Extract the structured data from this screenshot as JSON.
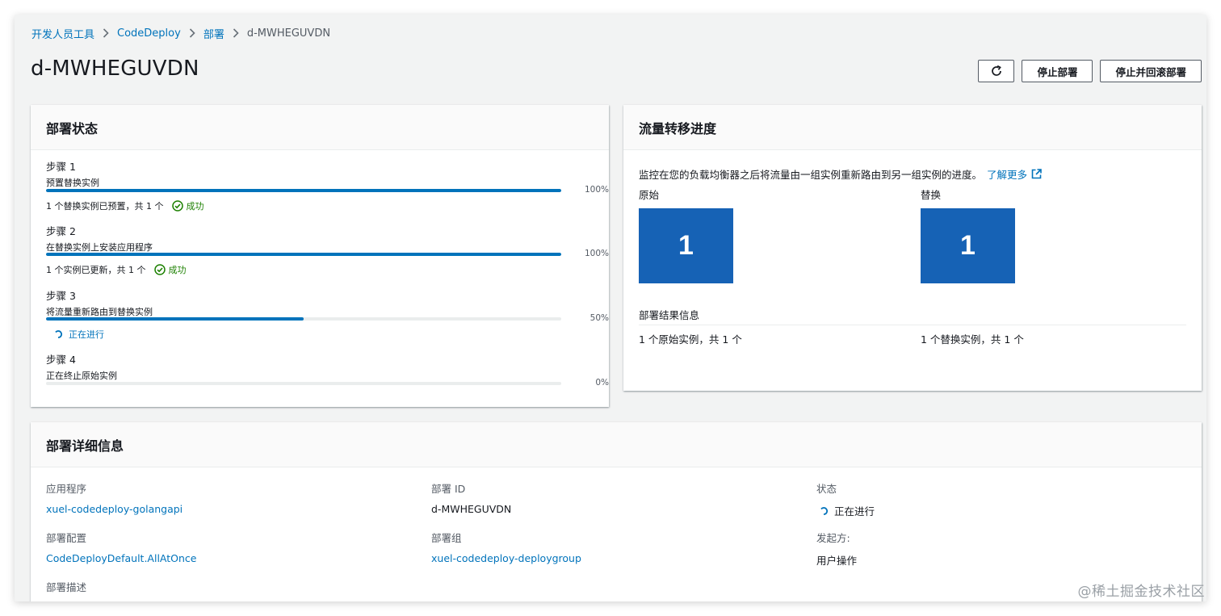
{
  "breadcrumb": {
    "items": [
      "开发人员工具",
      "CodeDeploy",
      "部署"
    ],
    "current": "d-MWHEGUVDN"
  },
  "page": {
    "title": "d-MWHEGUVDN"
  },
  "actions": {
    "refresh_icon": "refresh-icon",
    "stop_label": "停止部署",
    "stop_rollback_label": "停止并回滚部署"
  },
  "status_panel": {
    "title": "部署状态",
    "steps": [
      {
        "title": "步骤 1",
        "desc": "预置替换实例",
        "progress": 100,
        "pct_label": "100%",
        "footer": "1 个替换实例已预置，共 1 个",
        "status": "成功"
      },
      {
        "title": "步骤 2",
        "desc": "在替换实例上安装应用程序",
        "progress": 100,
        "pct_label": "100%",
        "footer": "1 个实例已更新，共 1 个",
        "status": "成功"
      },
      {
        "title": "步骤 3",
        "desc": "将流量重新路由到替换实例",
        "progress": 50,
        "pct_label": "50%",
        "status": "正在进行"
      },
      {
        "title": "步骤 4",
        "desc": "正在终止原始实例",
        "progress": 0,
        "pct_label": "0%"
      }
    ]
  },
  "traffic_panel": {
    "title": "流量转移进度",
    "desc": "监控在您的负载均衡器之后将流量由一组实例重新路由到另一组实例的进度。",
    "learn_more": "了解更多",
    "original_label": "原始",
    "replacement_label": "替换",
    "original_count": "1",
    "replacement_count": "1",
    "result_title": "部署结果信息",
    "original_result": "1 个原始实例，共 1 个",
    "replacement_result": "1 个替换实例，共 1 个"
  },
  "details_panel": {
    "title": "部署详细信息",
    "application_label": "应用程序",
    "application_value": "xuel-codedeploy-golangapi",
    "deployment_id_label": "部署 ID",
    "deployment_id_value": "d-MWHEGUVDN",
    "status_label": "状态",
    "status_value": "正在进行",
    "config_label": "部署配置",
    "config_value": "CodeDeployDefault.AllAtOnce",
    "group_label": "部署组",
    "group_value": "xuel-codedeploy-deploygroup",
    "initiator_label": "发起方:",
    "initiator_value": "用户操作",
    "description_label": "部署描述"
  },
  "watermark": "@稀土掘金技术社区",
  "colors": {
    "link": "#0073bb",
    "success": "#1d8102",
    "box": "#1662b5",
    "progress": "#0073bb"
  }
}
